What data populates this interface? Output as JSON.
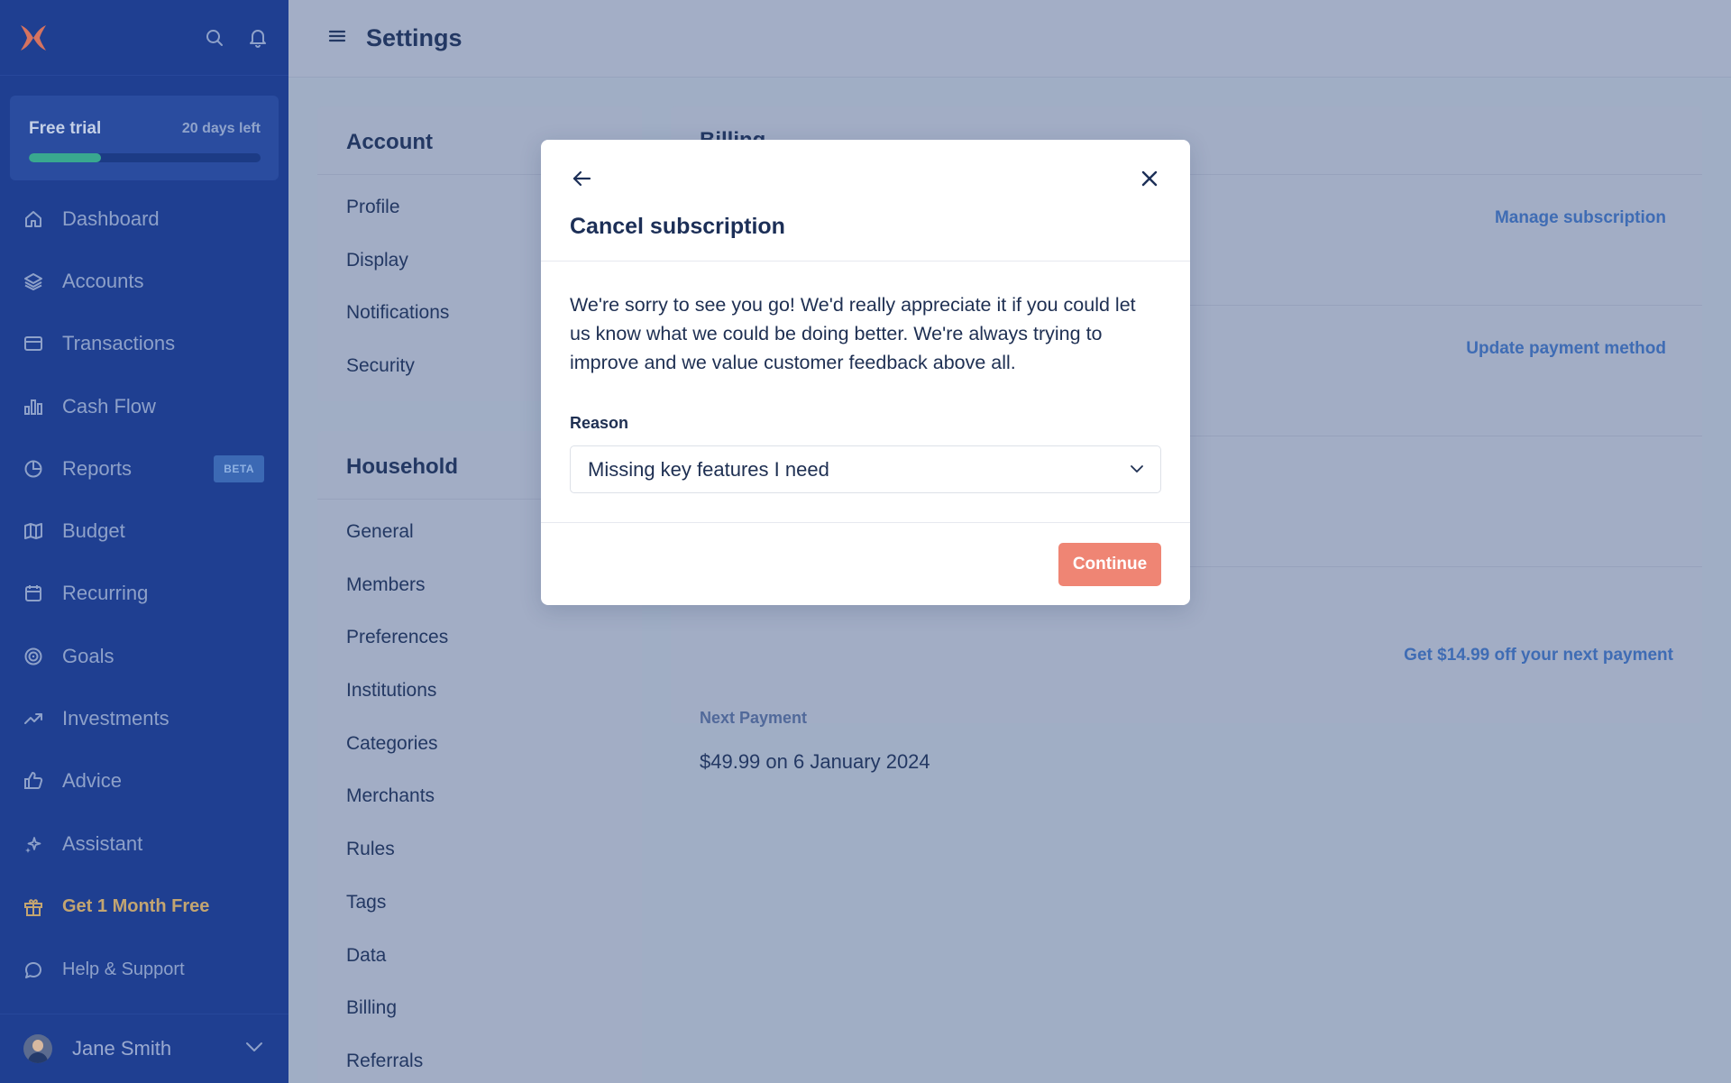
{
  "app": {
    "page_title": "Settings"
  },
  "sidebar": {
    "trial": {
      "label": "Free trial",
      "days_left": "20 days left",
      "progress_percent": 31
    },
    "nav": [
      {
        "label": "Dashboard",
        "icon": "home-icon"
      },
      {
        "label": "Accounts",
        "icon": "layers-icon"
      },
      {
        "label": "Transactions",
        "icon": "credit-card-icon"
      },
      {
        "label": "Cash Flow",
        "icon": "bar-chart-icon"
      },
      {
        "label": "Reports",
        "icon": "pie-chart-icon",
        "badge": "BETA"
      },
      {
        "label": "Budget",
        "icon": "map-icon"
      },
      {
        "label": "Recurring",
        "icon": "calendar-icon"
      },
      {
        "label": "Goals",
        "icon": "target-icon"
      },
      {
        "label": "Investments",
        "icon": "trending-up-icon"
      },
      {
        "label": "Advice",
        "icon": "thumbs-up-icon"
      },
      {
        "label": "Assistant",
        "icon": "sparkles-icon"
      }
    ],
    "promo": {
      "label": "Get 1 Month Free",
      "icon": "gift-icon"
    },
    "help": {
      "label": "Help & Support",
      "icon": "chat-bubble-icon"
    },
    "user": {
      "name": "Jane Smith"
    }
  },
  "settings_menu": {
    "account": {
      "title": "Account",
      "items": [
        "Profile",
        "Display",
        "Notifications",
        "Security"
      ]
    },
    "household": {
      "title": "Household",
      "items": [
        "General",
        "Members",
        "Preferences",
        "Institutions",
        "Categories",
        "Merchants",
        "Rules",
        "Tags",
        "Data",
        "Billing",
        "Referrals"
      ]
    }
  },
  "billing": {
    "title": "Billing",
    "manage_link": "Manage subscription",
    "update_payment_link": "Update payment method",
    "next_payment_label": "Next Payment",
    "next_payment_value": "$49.99 on 6 January 2024",
    "discount_link": "Get $14.99 off your next payment"
  },
  "modal": {
    "title": "Cancel subscription",
    "message": "We're sorry to see you go! We'd really appreciate it if you could let us know what we could be doing better. We're always trying to improve and we value customer feedback above all.",
    "reason_label": "Reason",
    "reason_value": "Missing key features I need",
    "continue_label": "Continue"
  },
  "colors": {
    "sidebar_bg": "#1f3f91",
    "accent_link": "#3f6cb4",
    "continue_button": "#ef8574",
    "progress_fill": "#39a88f",
    "promo_text": "#c3a571"
  }
}
